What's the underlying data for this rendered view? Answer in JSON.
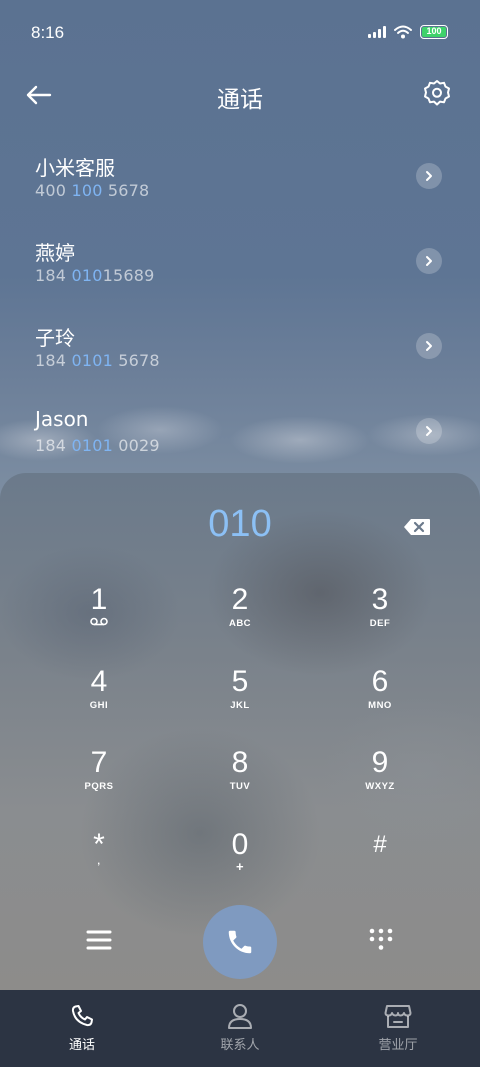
{
  "status_bar": {
    "time": "8:16",
    "battery": "100"
  },
  "header": {
    "title": "通话"
  },
  "contacts": [
    {
      "name": "小米客服",
      "num_pre": "400 ",
      "num_hl": "100",
      "num_post": " 5678"
    },
    {
      "name": "燕婷",
      "num_pre": "184 ",
      "num_hl": "010",
      "num_post": "15689"
    },
    {
      "name": "子玲",
      "num_pre": "184 ",
      "num_hl": "0101",
      "num_post": " 5678"
    },
    {
      "name": "Jason",
      "num_pre": "184 ",
      "num_hl": "0101",
      "num_post": " 0029"
    }
  ],
  "dialpad": {
    "display": "010",
    "keys": [
      {
        "digit": "1",
        "letters": ""
      },
      {
        "digit": "2",
        "letters": "ABC"
      },
      {
        "digit": "3",
        "letters": "DEF"
      },
      {
        "digit": "4",
        "letters": "GHI"
      },
      {
        "digit": "5",
        "letters": "JKL"
      },
      {
        "digit": "6",
        "letters": "MNO"
      },
      {
        "digit": "7",
        "letters": "PQRS"
      },
      {
        "digit": "8",
        "letters": "TUV"
      },
      {
        "digit": "9",
        "letters": "WXYZ"
      },
      {
        "digit": "*",
        "letters": ","
      },
      {
        "digit": "0",
        "letters": "+"
      },
      {
        "digit": "#",
        "letters": ""
      }
    ]
  },
  "nav": {
    "calls": "通话",
    "contacts": "联系人",
    "store": "营业厅"
  },
  "colors": {
    "accent": "#8cc0f5",
    "call_button": "#7f9ac0",
    "battery": "#3fd26b",
    "nav_bg": "#2c3443"
  }
}
